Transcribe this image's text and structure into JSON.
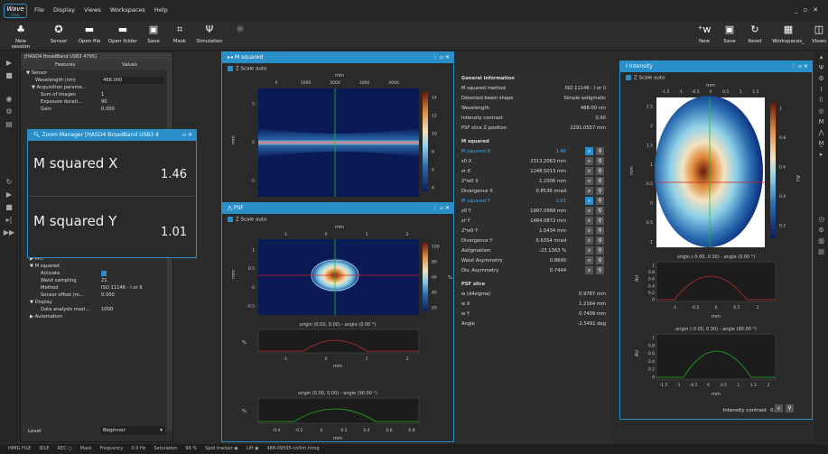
{
  "app": {
    "logo": "Wave",
    "logo_sub": "View",
    "menu": [
      "File",
      "Display",
      "Views",
      "Workspaces",
      "Help"
    ]
  },
  "toolbar": {
    "left": [
      "New session",
      "Sensor",
      "Open file",
      "Open folder",
      "Save",
      "Mask",
      "Simulation"
    ],
    "right": [
      "New",
      "Save",
      "Reset",
      "Workspaces_",
      "Views"
    ]
  },
  "left_panel": {
    "title": "[HASO4 BroadBand USB3 4795]",
    "col_features": "Features",
    "col_values": "Values",
    "tree_top": [
      [
        "▼ Sensor",
        ""
      ],
      [
        "Wavelength (nm)",
        "488.000"
      ],
      [
        "▼ Acquisition parame...",
        ""
      ],
      [
        "Sum of images",
        "1"
      ],
      [
        "Exposure durati...",
        "90"
      ],
      [
        "Gain",
        "0.000"
      ]
    ],
    "tree_bottom": [
      [
        "▶ MTF",
        ""
      ],
      [
        "▼ M squared",
        ""
      ],
      [
        "Activate",
        ""
      ],
      [
        "Waist sampling",
        "21"
      ],
      [
        "Method",
        "ISO 11146 - I or II"
      ],
      [
        "Sensor offset (m...",
        "0.000"
      ],
      [
        "▼ Display",
        ""
      ],
      [
        "Data analysis maxi...",
        "1000"
      ],
      [
        "▶ Automation",
        ""
      ]
    ],
    "level_label": "Level",
    "level_value": "Beginner"
  },
  "zoom": {
    "title": "Zoom Manager [HASO4 BroadBand USB3 4",
    "x_label": "M squared X",
    "x_value": "1.46",
    "y_label": "M squared Y",
    "y_value": "1.01"
  },
  "msq": {
    "title": "M squared",
    "zscale": "Z Scale auto",
    "axis_unit": "mm",
    "yunit": "mm",
    "top_ticks": [
      "0",
      "1000",
      "2000",
      "3000",
      "4000"
    ],
    "left_ticks": [
      "5",
      "0",
      "-5"
    ],
    "cbar_ticks": [
      "14",
      "12",
      "10",
      "8",
      "6",
      "4"
    ]
  },
  "psf": {
    "title": "PSF",
    "zscale": "Z Scale auto",
    "axis_unit": "mm",
    "yunit": "mm",
    "top_ticks": [
      "-1",
      "0",
      "1",
      "2"
    ],
    "left_ticks": [
      "1",
      "0.5",
      "0",
      "-0.5"
    ],
    "cbar_ticks": [
      "100",
      "80",
      "60",
      "40",
      "20"
    ],
    "cbar_unit": "%",
    "prof1_title": "origin (0.00, 0.00) - angle (0.00 °)",
    "prof1_ticks": [
      "-1",
      "0",
      "1",
      "2"
    ],
    "prof2_title": "origin (0.00, 0.00) - angle (90.00 °)",
    "prof2_ticks": [
      "-0.4",
      "-0.2",
      "0",
      "0.2",
      "0.4",
      "0.6",
      "0.8"
    ],
    "prof_yunit": "%",
    "prof_xunit": "mm"
  },
  "info": {
    "general_title": "General information",
    "general": [
      [
        "M squared method",
        "ISO 11146 - I or II"
      ],
      [
        "Detected beam shape",
        "Simple astigmatic"
      ],
      [
        "Wavelength",
        "488.00 nm"
      ],
      [
        "Intensity contrast",
        "0.90"
      ],
      [
        "PSF slice Z position",
        "2291.0557 mm"
      ]
    ],
    "msq_title": "M squared",
    "msq": [
      [
        "M squared X",
        "1.46"
      ],
      [
        "z0 X",
        "2313.2063 mm"
      ],
      [
        "zr X",
        "1248.5013 mm"
      ],
      [
        "2*w0 X",
        "1.2006 mm"
      ],
      [
        "Divergence X",
        "0.8536 mrad"
      ],
      [
        "M squared Y",
        "1.01"
      ],
      [
        "z0 Y",
        "1997.0968 mm"
      ],
      [
        "zr Y",
        "1484.0872 mm"
      ],
      [
        "2*w0 Y",
        "1.0434 mm"
      ],
      [
        "Divergence Y",
        "0.6354 mrad"
      ],
      [
        "Astigmatism",
        "-23.1363 %"
      ],
      [
        "Waist Asymmetry",
        "0.8690"
      ],
      [
        "Div. Asymmetry",
        "0.7444"
      ]
    ],
    "psf_title": "PSF slice",
    "psf": [
      [
        "w (d4sigma)",
        "0.9787 mm"
      ],
      [
        "w X",
        "1.2164 mm"
      ],
      [
        "w Y",
        "0.7409 mm"
      ],
      [
        "Angle",
        "-2.5491 deg"
      ]
    ]
  },
  "intensity": {
    "title": "Intensity",
    "zscale": "Z Scale auto",
    "axis_unit": "mm",
    "top_ticks": [
      "-1.5",
      "-1",
      "-0.5",
      "0",
      "0.5",
      "1",
      "1.5"
    ],
    "left_ticks": [
      "2.5",
      "2",
      "1.5",
      "1",
      "0.5",
      "0",
      "-0.5",
      "-1"
    ],
    "cbar_ticks": [
      "1",
      "0.8",
      "0.6",
      "0.4",
      "0.2"
    ],
    "cbar_unit": "AU",
    "yunit": "mm",
    "prof1_title": "origin (-0.00, 0.30) - angle (0.00 °)",
    "prof1_ticks": [
      "-1",
      "-0.5",
      "0",
      "0.5",
      "1"
    ],
    "prof2_title": "origin (-0.00, 0.30) - angle (90.00 °)",
    "prof2_ticks": [
      "-1.5",
      "-1",
      "-0.5",
      "0",
      "0.5",
      "1",
      "1.5",
      "2"
    ],
    "prof_yunit": "AU",
    "prof_xunit": "mm",
    "prof_yticks": [
      "1",
      "0.8",
      "0.6",
      "0.4",
      "0.2",
      "0"
    ],
    "contrast_label": "Intensity contrast",
    "contrast_value": "0.90"
  },
  "status": {
    "items": [
      "HIMG FILE",
      "IDLE",
      "REC ○",
      "Mask",
      "Frequency",
      "0.0 Hz",
      "Saturation",
      "96 %",
      "Spot tracker ◉",
      "Lift ◉",
      "488-09595-collim.himg"
    ]
  },
  "colors": {
    "accent": "#2a8fc9",
    "bg": "#2b2b2b",
    "highlight": "#3fa9e6"
  }
}
